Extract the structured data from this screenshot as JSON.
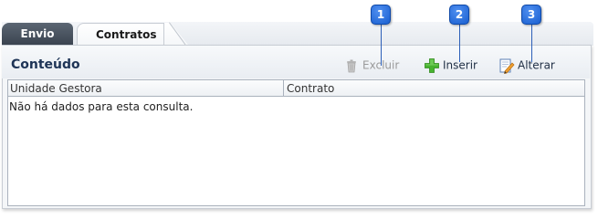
{
  "tabs": [
    {
      "label": "Envio",
      "active": false
    },
    {
      "label": "Contratos",
      "active": true
    }
  ],
  "panel": {
    "title": "Conteúdo"
  },
  "toolbar": {
    "excluir_label": "Excluir",
    "excluir_icon": "trash-icon",
    "excluir_enabled": false,
    "inserir_label": "Inserir",
    "inserir_icon": "plus-icon",
    "alterar_label": "Alterar",
    "alterar_icon": "edit-icon"
  },
  "table": {
    "columns": [
      "Unidade Gestora",
      "Contrato"
    ],
    "rows": [],
    "empty_message": "Não há dados para esta consulta."
  },
  "callouts": [
    "1",
    "2",
    "3"
  ],
  "colors": {
    "panel_title": "#1e3456",
    "active_tab_text": "#1a1a1a",
    "inactive_tab_bg": "#3b4450",
    "callout_blue": "#1a5fd0",
    "plus_green": "#3fae2a"
  }
}
